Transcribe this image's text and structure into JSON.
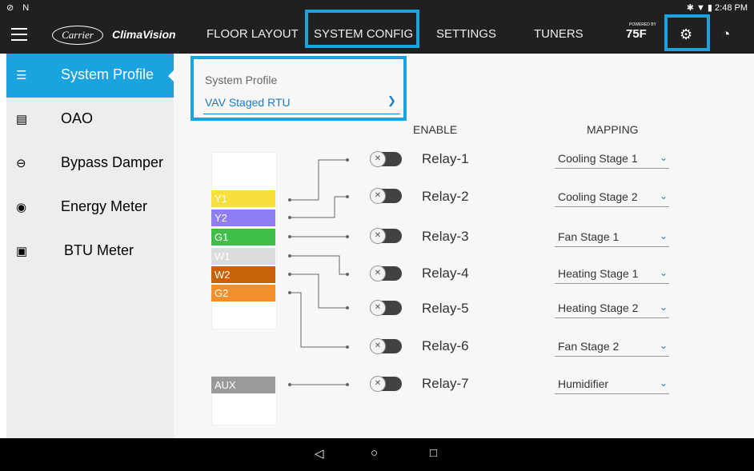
{
  "status": {
    "left": "⊘ N",
    "right": "✱ ▼ ▮ 2:48 PM"
  },
  "app": {
    "logo": "Carrier",
    "brand": "ClimaVision"
  },
  "nav": {
    "tabs": [
      "FLOOR LAYOUT",
      "SYSTEM CONFIG",
      "SETTINGS",
      "TUNERS"
    ],
    "powered_by": "POWERED BY",
    "logo_75f": "75F"
  },
  "sidebar": {
    "items": [
      {
        "label": "System Profile"
      },
      {
        "label": "OAO"
      },
      {
        "label": "Bypass Damper"
      },
      {
        "label": "Energy Meter"
      },
      {
        "label": "BTU Meter"
      }
    ]
  },
  "profile": {
    "label": "System Profile",
    "value": "VAV Staged RTU"
  },
  "columns": {
    "enable": "ENABLE",
    "mapping": "MAPPING"
  },
  "terminals": [
    {
      "label": "Y1",
      "color": "#f7df3e"
    },
    {
      "label": "Y2",
      "color": "#8d7ef3"
    },
    {
      "label": "G1",
      "color": "#3fbf4a"
    },
    {
      "label": "W1",
      "color": "#dcdcdc"
    },
    {
      "label": "W2",
      "color": "#c8620a"
    },
    {
      "label": "G2",
      "color": "#f28e2b"
    }
  ],
  "aux": {
    "label": "AUX",
    "color": "#9a9a9a"
  },
  "relays": [
    {
      "name": "Relay-1",
      "mapping": "Cooling Stage 1"
    },
    {
      "name": "Relay-2",
      "mapping": "Cooling Stage 2"
    },
    {
      "name": "Relay-3",
      "mapping": "Fan Stage 1"
    },
    {
      "name": "Relay-4",
      "mapping": "Heating Stage 1"
    },
    {
      "name": "Relay-5",
      "mapping": "Heating Stage 2"
    },
    {
      "name": "Relay-6",
      "mapping": "Fan Stage 2"
    },
    {
      "name": "Relay-7",
      "mapping": "Humidifier"
    }
  ],
  "accent_color": "#1aa3df"
}
